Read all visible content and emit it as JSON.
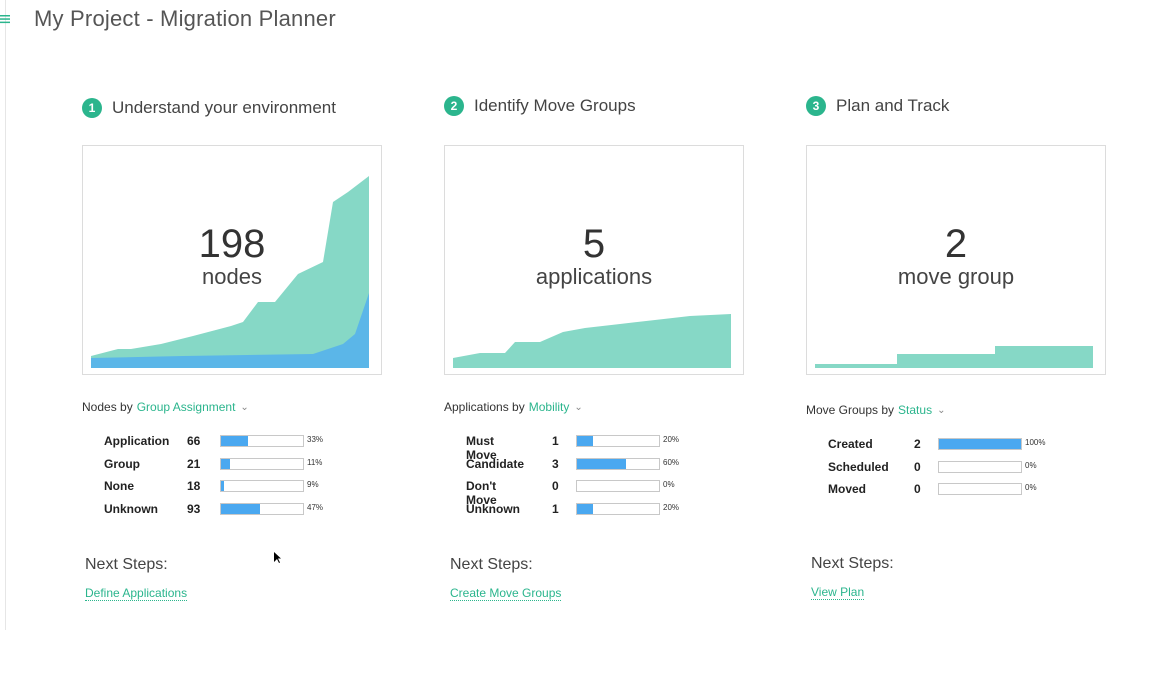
{
  "page": {
    "title": "My Project - Migration Planner"
  },
  "columns": [
    {
      "step": "1",
      "title": "Understand your environment",
      "big_value": "198",
      "big_unit": "nodes",
      "by_label": "Nodes by",
      "by_field": "Group Assignment",
      "stats": [
        {
          "label": "Application",
          "count": "66",
          "pct": "33%",
          "fraction": 0.33
        },
        {
          "label": "Group",
          "count": "21",
          "pct": "11%",
          "fraction": 0.11
        },
        {
          "label": "None",
          "count": "18",
          "pct": "9%",
          "fraction": 0.04
        },
        {
          "label": "Unknown",
          "count": "93",
          "pct": "47%",
          "fraction": 0.47
        }
      ],
      "next_steps_label": "Next Steps:",
      "next_link": "Define Applications"
    },
    {
      "step": "2",
      "title": "Identify Move Groups",
      "big_value": "5",
      "big_unit": "applications",
      "by_label": "Applications by",
      "by_field": "Mobility",
      "stats": [
        {
          "label": "Must Move",
          "count": "1",
          "pct": "20%",
          "fraction": 0.2
        },
        {
          "label": "Candidate",
          "count": "3",
          "pct": "60%",
          "fraction": 0.6
        },
        {
          "label": "Don't Move",
          "count": "0",
          "pct": "0%",
          "fraction": 0
        },
        {
          "label": "Unknown",
          "count": "1",
          "pct": "20%",
          "fraction": 0.2
        }
      ],
      "next_steps_label": "Next Steps:",
      "next_link": "Create Move Groups"
    },
    {
      "step": "3",
      "title": "Plan and Track",
      "big_value": "2",
      "big_unit": "move group",
      "by_label": "Move Groups by",
      "by_field": "Status",
      "stats": [
        {
          "label": "Created",
          "count": "2",
          "pct": "100%",
          "fraction": 1
        },
        {
          "label": "Scheduled",
          "count": "0",
          "pct": "0%",
          "fraction": 0
        },
        {
          "label": "Moved",
          "count": "0",
          "pct": "0%",
          "fraction": 0
        }
      ],
      "next_steps_label": "Next Steps:",
      "next_link": "View Plan"
    }
  ],
  "colors": {
    "accent": "#2bb58d",
    "area_green": "#86d8c6",
    "area_blue": "#5bb6e8",
    "bar_fill": "#4aa8f0"
  },
  "icons": {
    "menu": "menu-icon"
  }
}
